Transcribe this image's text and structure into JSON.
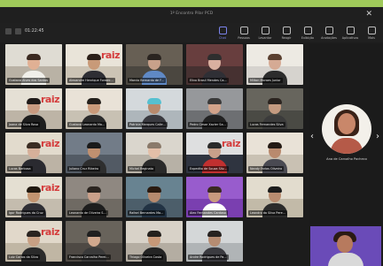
{
  "window": {
    "title": "1º Encontro Pilar PCD",
    "close_glyph": "✕"
  },
  "meeting": {
    "timer": "01:22:45"
  },
  "toolbar": {
    "items": [
      {
        "label": "Chat",
        "icon": "chat-icon",
        "active": true
      },
      {
        "label": "Pessoas",
        "icon": "people-icon"
      },
      {
        "label": "Levantar",
        "icon": "raise-hand-icon"
      },
      {
        "label": "Reagir",
        "icon": "react-icon"
      },
      {
        "label": "Exibição",
        "icon": "view-icon"
      },
      {
        "label": "Anotações",
        "icon": "notes-icon"
      },
      {
        "label": "Aplicativos",
        "icon": "apps-icon"
      },
      {
        "label": "Mais",
        "icon": "more-icon"
      }
    ]
  },
  "participants": [
    {
      "name": "Gustavo Alves dos Santos",
      "bg": "#b9b2a5",
      "wall": "#e3e0d8",
      "skin": "#e0b094",
      "hair": "#3b2a20",
      "shirt": "#f0efe9",
      "logo": ""
    },
    {
      "name": "Alexandre Henrique Fonsec...",
      "bg": "#ccc4b5",
      "wall": "#ece8dd",
      "skin": "#c89a78",
      "hair": "#2b1f18",
      "shirt": "#2e2e34",
      "logo": "raiz"
    },
    {
      "name": "Marcio Bernardo de F...",
      "bg": "#4b4740",
      "wall": "#6a6257",
      "skin": "#c8a18a",
      "hair": "#2a2420",
      "shirt": "#5f89c5",
      "logo": ""
    },
    {
      "name": "Elivo Brasil Mendes Ca...",
      "bg": "#463131",
      "wall": "#6b4040",
      "skin": "#d9b0a0",
      "hair": "#2e2e2e",
      "shirt": "#2f2f35",
      "logo": ""
    },
    {
      "name": "Milton Moraes Junior",
      "bg": "#d6d3ce",
      "wall": "#f0ece6",
      "skin": "#d5aa94",
      "hair": "#5a4030",
      "shirt": "#2c2c2c",
      "logo": ""
    },
    {
      "name": "Joana de Silva Rosa",
      "bg": "#bdb4a6",
      "wall": "#e9e4da",
      "skin": "#c89a80",
      "hair": "#1f1a18",
      "shirt": "#1e1e1e",
      "logo": "raiz"
    },
    {
      "name": "Gustavo Leonardo Ma...",
      "bg": "#c8c1b3",
      "wall": "#ece6da",
      "skin": "#c99a7a",
      "hair": "#24201c",
      "shirt": "#2c2c2c",
      "logo": ""
    },
    {
      "name": "Patricia Marques Calle...",
      "bg": "#aeb6bb",
      "wall": "#d8dde0",
      "skin": "#b88a6d",
      "hair": "#55c0d0",
      "shirt": "#3a3a40",
      "logo": ""
    },
    {
      "name": "Pedro Cesar Xavier Sa...",
      "bg": "#6d6f72",
      "wall": "#9a9ca0",
      "skin": "#d2a38a",
      "hair": "#3a3a3a",
      "shirt": "#222222",
      "logo": ""
    },
    {
      "name": "Lucas Fernandes Silva",
      "bg": "#4a4a44",
      "wall": "#6a6860",
      "skin": "#c49a80",
      "hair": "#2b2420",
      "shirt": "#3b3b3b",
      "logo": ""
    },
    {
      "name": "Lucas Barbosa",
      "bg": "#bcb3a5",
      "wall": "#e6dfd2",
      "skin": "#d6b09a",
      "hair": "#3a2c22",
      "shirt": "#2a2a30",
      "logo": "raiz"
    },
    {
      "name": "Juliano Cruz Ribeiro",
      "bg": "#525a64",
      "wall": "#76808c",
      "skin": "#c09070",
      "hair": "#1a1a1a",
      "shirt": "#2e2e2e",
      "logo": ""
    },
    {
      "name": "Michel Reginato",
      "bg": "#b7b1a6",
      "wall": "#dedad2",
      "skin": "#e3bfa8",
      "hair": "#8a7a6a",
      "shirt": "#2a2a2a",
      "logo": ""
    },
    {
      "name": "Expedito de Souza Silv...",
      "bg": "#2f3440",
      "wall": "#f2f2f2",
      "skin": "#c8a08a",
      "hair": "#2a2a2a",
      "shirt": "#c03030",
      "logo": "raiz"
    },
    {
      "name": "Nandy Farias Oliveira",
      "bg": "#c9c1b3",
      "wall": "#ece6da",
      "skin": "#b98a6e",
      "hair": "#241a14",
      "shirt": "#4a4a52",
      "logo": ""
    },
    {
      "name": "Igor Rodrigues da Cruz",
      "bg": "#c4bcae",
      "wall": "#e8e2d6",
      "skin": "#c29470",
      "hair": "#20180f",
      "shirt": "#2f2f35",
      "logo": "raiz"
    },
    {
      "name": "Leonardo de Oliveira S...",
      "bg": "#6f6a63",
      "wall": "#928c84",
      "skin": "#caa08a",
      "hair": "#2b2520",
      "shirt": "#1e1e1e",
      "logo": ""
    },
    {
      "name": "Rafael Bernardes Ma...",
      "bg": "#4c5e6a",
      "wall": "#6b8796",
      "skin": "#b68a6e",
      "hair": "#2a1a10",
      "shirt": "#223344",
      "logo": ""
    },
    {
      "name": "Alex Fernandes Cardoso",
      "bg": "#7a3fb0",
      "wall": "#9b5fd0",
      "skin": "#c89a7e",
      "hair": "#3a2a22",
      "shirt": "#ffffff",
      "logo": ""
    },
    {
      "name": "Leandro da Silva Pere...",
      "bg": "#c2baa8",
      "wall": "#e6e0d2",
      "skin": "#b88c70",
      "hair": "#1c1c1c",
      "shirt": "#2b2b2b",
      "logo": ""
    },
    {
      "name": "Luiz Carlos da Silva",
      "bg": "#c0b6a4",
      "wall": "#e4dcce",
      "skin": "#c8a084",
      "hair": "#2a2420",
      "shirt": "#2a2a2a",
      "logo": "raiz"
    },
    {
      "name": "Francisco Carvalho Perei...",
      "bg": "#4e4944",
      "wall": "#6c665e",
      "skin": "#d0a88e",
      "hair": "#1f1f1f",
      "shirt": "#3a3a3a",
      "logo": ""
    },
    {
      "name": "Thiago Oliveira Costa",
      "bg": "#b4ada2",
      "wall": "#dcd6cc",
      "skin": "#c69878",
      "hair": "#23201d",
      "shirt": "#242424",
      "logo": ""
    },
    {
      "name": "Andre Rodrigues de Pa...",
      "bg": "#b0b4b6",
      "wall": "#d8dadc",
      "skin": "#b58c72",
      "hair": "#262220",
      "shirt": "#3b3b40",
      "logo": ""
    }
  ],
  "featured": {
    "name": "Ana de Carvalho Pacheco",
    "prev_glyph": "‹",
    "next_glyph": "›"
  }
}
